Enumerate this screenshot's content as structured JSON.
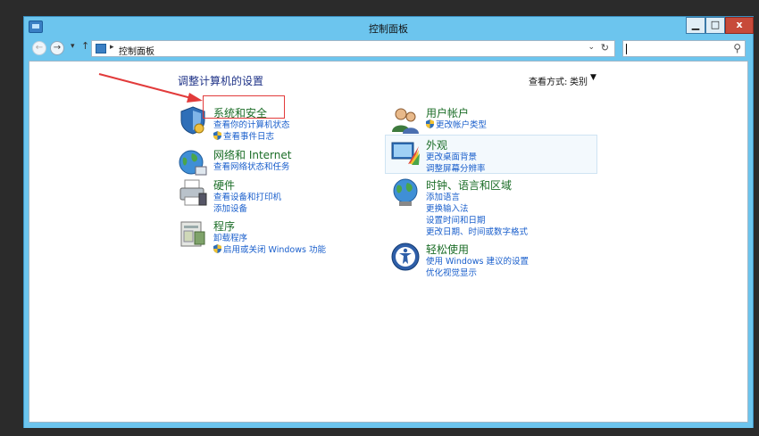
{
  "window": {
    "title": "控制面板",
    "min_label": "▁",
    "max_label": "□",
    "close_label": "x"
  },
  "nav": {
    "breadcrumb_sep": "▸",
    "address_text": "控制面板",
    "search_placeholder": ""
  },
  "main": {
    "heading": "调整计算机的设置",
    "view_by_label": "查看方式:",
    "view_by_value": "类别"
  },
  "categories": [
    {
      "title": "系统和安全",
      "links": [
        "查看你的计算机状态",
        "查看事件日志"
      ],
      "link_shield": [
        false,
        true
      ]
    },
    {
      "title": "网络和 Internet",
      "links": [
        "查看网络状态和任务"
      ],
      "link_shield": [
        false
      ]
    },
    {
      "title": "硬件",
      "links": [
        "查看设备和打印机",
        "添加设备"
      ],
      "link_shield": [
        false,
        false
      ]
    },
    {
      "title": "程序",
      "links": [
        "卸载程序",
        "启用或关闭 Windows 功能"
      ],
      "link_shield": [
        false,
        true
      ]
    },
    {
      "title": "用户帐户",
      "links": [
        "更改帐户类型"
      ],
      "link_shield": [
        true
      ]
    },
    {
      "title": "外观",
      "links": [
        "更改桌面背景",
        "调整屏幕分辨率"
      ],
      "link_shield": [
        false,
        false
      ]
    },
    {
      "title": "时钟、语言和区域",
      "links": [
        "添加语言",
        "更换输入法",
        "设置时间和日期",
        "更改日期、时间或数字格式"
      ],
      "link_shield": [
        false,
        false,
        false,
        false
      ]
    },
    {
      "title": "轻松使用",
      "links": [
        "使用 Windows 建议的设置",
        "优化视觉显示"
      ],
      "link_shield": [
        false,
        false
      ]
    }
  ],
  "colors": {
    "frame": "#6cc5ee",
    "category_title": "#1b6d27",
    "link": "#1a5fcc",
    "annotation": "#e23b3b"
  }
}
